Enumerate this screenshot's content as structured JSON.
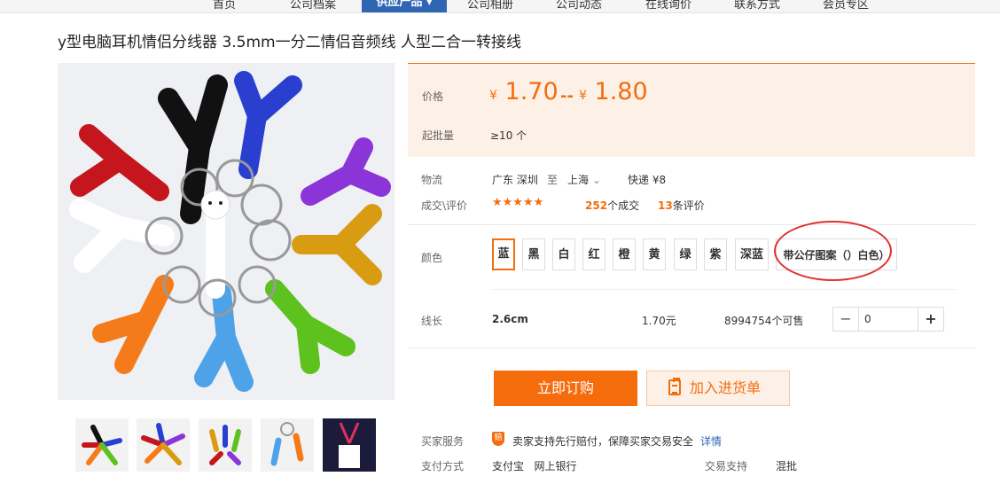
{
  "nav": {
    "items": [
      "首页",
      "公司档案",
      "公司相册",
      "公司动态",
      "在线询价",
      "联系方式",
      "会员专区"
    ],
    "active": "供应产品 ▾"
  },
  "product": {
    "title": "y型电脑耳机情侣分线器 3.5mm一分二情侣音频线 人型二合一转接线"
  },
  "price": {
    "label": "价格",
    "currency": "¥",
    "low": "1.70",
    "separator": "--",
    "high": "1.80",
    "moq_label": "起批量",
    "moq_value": "≥10 个"
  },
  "logistics": {
    "label": "物流",
    "from": "广东 深圳",
    "to_word": "至",
    "to": "上海",
    "shipping": "快递 ¥8"
  },
  "deals": {
    "label": "成交\\评价",
    "stars": "★★★★★",
    "sold_count": "252",
    "sold_suffix": "个成交",
    "review_count": "13",
    "review_suffix": "条评价"
  },
  "colors": {
    "label": "颜色",
    "options": [
      "蓝",
      "黑",
      "白",
      "红",
      "橙",
      "黄",
      "绿",
      "紫",
      "深蓝",
      "带公仔图案（）白色）"
    ],
    "selected": "蓝"
  },
  "spec": {
    "label": "线长",
    "length": "2.6cm",
    "unit_price": "1.70元",
    "stock": "8994754个可售",
    "quantity": "0"
  },
  "actions": {
    "order": "立即订购",
    "add_to_list": "加入进货单"
  },
  "service": {
    "buyer_label": "买家服务",
    "shield_glyph": "赔",
    "guarantee": "卖家支持先行赔付，保障买家交易安全",
    "details_link": "详情",
    "pay_label": "支付方式",
    "pay_methods": "支付宝   网上银行",
    "trade_label": "交易支持",
    "trade_value": "混批"
  },
  "colors_theme": {
    "accent": "#f56c0d",
    "nav_blue": "#2f66b3",
    "price_bg": "#fdf1e7",
    "annotation": "#e0302b"
  }
}
